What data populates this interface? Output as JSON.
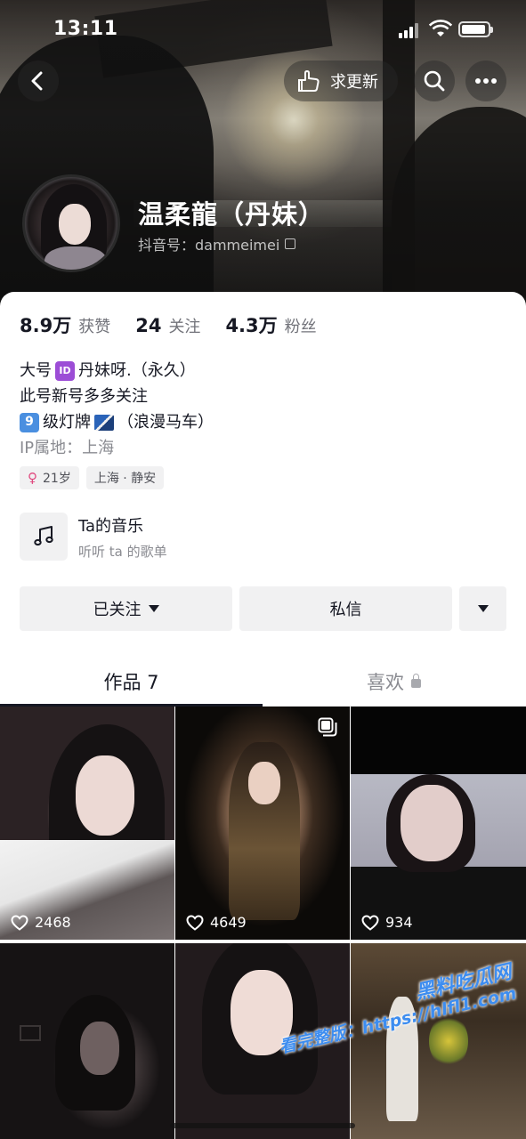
{
  "status_bar": {
    "time": "13:11"
  },
  "header": {
    "update_label": "求更新",
    "name": "温柔龍（丹妹）",
    "douyin_id": "抖音号：dammeimei"
  },
  "stats": [
    {
      "num": "8.9万",
      "label": "获赞"
    },
    {
      "num": "24",
      "label": "关注"
    },
    {
      "num": "4.3万",
      "label": "粉丝"
    }
  ],
  "bio": {
    "line1_pre": "大号",
    "line1_badge": "ID",
    "line1_post": "丹妹呀.（永久）",
    "line2": "此号新号多多关注",
    "line3_badge": "9",
    "line3_mid": "级灯牌",
    "line3_post": "（浪漫马车）",
    "ip": "IP属地：上海"
  },
  "tags": {
    "age": "21岁",
    "location": "上海 · 静安"
  },
  "music": {
    "title": "Ta的音乐",
    "subtitle": "听听 ta 的歌单"
  },
  "actions": {
    "follow": "已关注",
    "message": "私信"
  },
  "tabs": {
    "works": "作品 7",
    "likes": "喜欢"
  },
  "grid": [
    {
      "likes": "2468"
    },
    {
      "likes": "4649"
    },
    {
      "likes": "934"
    }
  ],
  "watermark": {
    "line1": "黑料吃瓜网",
    "line2": "看完整版：https://hlfl1.com"
  }
}
